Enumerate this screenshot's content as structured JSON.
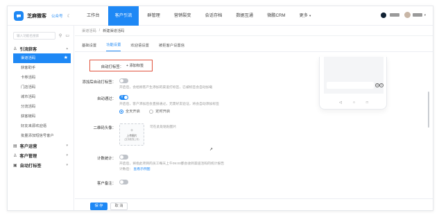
{
  "topbar": {
    "logo_text": "芝麻微客",
    "logo_sub": "公众号",
    "nav": [
      "工作台",
      "客户引流",
      "群管理",
      "营销裂变",
      "会话存档",
      "数据互通",
      "微鹏CRM",
      "更多"
    ],
    "active_nav": 1
  },
  "sidebar": {
    "search_placeholder": "输入功能名搜索",
    "groups": [
      {
        "label": "引流获客",
        "items": [
          "渠道活码",
          "获客助手",
          "卡券活码",
          "门店活码",
          "城市活码",
          "分流活码",
          "获客链码",
          "好友来源欢迎语",
          "批量添加短信号客户"
        ]
      },
      {
        "label": "客户运营",
        "items": []
      },
      {
        "label": "客户管理",
        "items": []
      },
      {
        "label": "自动打标签",
        "items": []
      }
    ],
    "active_item": "渠道活码"
  },
  "content": {
    "breadcrumb": [
      "渠道活码",
      "新建渠道活码"
    ],
    "tabs": [
      "基础设置",
      "功能设置",
      "欢迎语设置",
      "被拒客户设置信"
    ],
    "active_tab": 1,
    "form": {
      "auto_tag_label": "自动打标签：",
      "add_tag_label": "+ 添加标签",
      "remark_label": "添加后自动打标签：",
      "remark_hint": "开启后，会给顾客产生添加的渠道打标签，已被标签会自动加载",
      "auto_pass_label": "自动通过：",
      "auto_pass_toggle": "开",
      "auto_pass_hint": "开启后，客户添加后会直接通过，无需好友验证，将会自动添加标签",
      "radio_all": "全天开启",
      "radio_timed": "定时开启",
      "qr_label": "二维码头像：",
      "qr_upload_title": "上传图片",
      "qr_upload_sub": "(支持拖拽上传)",
      "qr_hint": "可在此处粘贴图片",
      "stats_label": "计数统计：",
      "stats_hint": "开启后，将指此项目的员工每天上午09:00都会收到渠道活码的统计报告",
      "stats_hint2": "计数后：",
      "stats_link": "查看示例图",
      "customer_note_label": "客户备注："
    },
    "footer": {
      "save": "保 存",
      "cancel": "取 消"
    }
  },
  "colors": {
    "accent": "#1e88f5",
    "highlight": "#e0523c"
  }
}
